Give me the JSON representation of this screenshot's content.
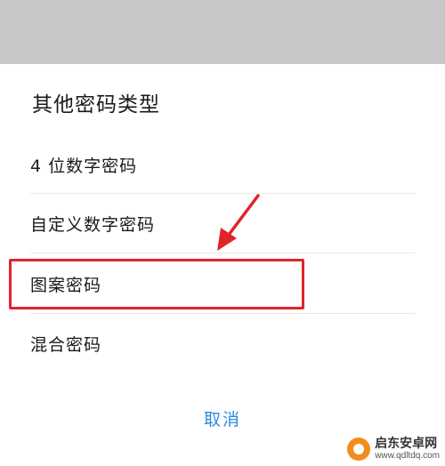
{
  "sheet": {
    "title": "其他密码类型",
    "options": [
      {
        "label": "4 位数字密码"
      },
      {
        "label": "自定义数字密码"
      },
      {
        "label": "图案密码"
      },
      {
        "label": "混合密码"
      }
    ],
    "cancel_label": "取消"
  },
  "annotation": {
    "highlighted_option": "图案密码",
    "highlight_color": "#e0242c"
  },
  "watermark": {
    "title": "启东安卓网",
    "url": "www.qdltdq.com"
  },
  "colors": {
    "accent": "#2a8ae0",
    "backdrop": "#c8c8c8"
  }
}
